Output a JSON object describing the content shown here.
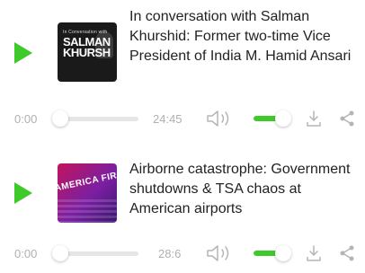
{
  "colors": {
    "accent": "#3fca2c",
    "icon_gray": "#b5b5b5",
    "track": "#e6e6e6",
    "text": "#222222",
    "time_text": "#b0b0b0"
  },
  "episodes": [
    {
      "title": "In conversation with Salman Khurshid: Former two-time Vice President of India M. Hamid Ansari",
      "thumbnail": {
        "small_text": "In Conversation with",
        "big_text_line1": "SALMAN",
        "big_text_line2": "KHURSH"
      },
      "time_current": "0:00",
      "time_total": "24:45",
      "progress": 0,
      "volume": 0.7
    },
    {
      "title": "Airborne catastrophe: Government shutdowns & TSA chaos at American airports",
      "thumbnail": {
        "big_text": "AMERICA FIRST"
      },
      "time_current": "0:00",
      "time_total": "28:6",
      "progress": 0,
      "volume": 0.7
    }
  ],
  "icons": {
    "play": "play-icon",
    "volume": "speaker-icon",
    "download": "download-icon",
    "share": "share-icon"
  }
}
